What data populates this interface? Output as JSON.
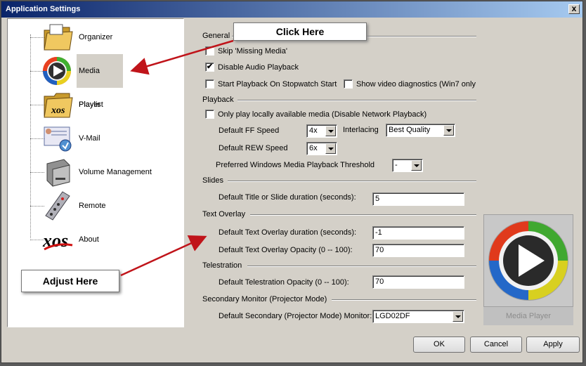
{
  "window": {
    "title": "Application Settings",
    "close_label": "x"
  },
  "sidebar": {
    "items": [
      {
        "label": "Organizer",
        "icon": "folder-icon"
      },
      {
        "label": "Media Player",
        "icon": "media-player-icon"
      },
      {
        "label": "Playlist",
        "icon": "playlist-folder-icon"
      },
      {
        "label": "V-Mail",
        "icon": "vmail-icon"
      },
      {
        "label": "Volume Management",
        "icon": "hard-drive-icon"
      },
      {
        "label": "Remote",
        "icon": "remote-control-icon"
      },
      {
        "label": "About",
        "icon": "xos-logo-icon"
      }
    ],
    "selected": "Media Player"
  },
  "general": {
    "title": "General",
    "skip_missing": {
      "label": "Skip 'Missing Media'",
      "checked": false
    },
    "disable_audio": {
      "label": "Disable Audio Playback",
      "checked": true
    },
    "start_playback": {
      "label": "Start Playback On Stopwatch Start",
      "checked": false
    },
    "show_diagnostics": {
      "label": "Show video diagnostics (Win7 only",
      "checked": false
    }
  },
  "playback": {
    "title": "Playback",
    "local_only": {
      "label": "Only play locally available media (Disable Network Playback)",
      "checked": false
    },
    "ff_label": "Default FF Speed",
    "ff_value": "4x",
    "interlacing_label": "Interlacing",
    "interlacing_value": "Best Quality",
    "rew_label": "Default REW Speed",
    "rew_value": "6x",
    "threshold_label": "Preferred Windows Media Playback Threshold",
    "threshold_value": "-"
  },
  "slides": {
    "title": "Slides",
    "duration_label": "Default Title or Slide duration (seconds):",
    "duration_value": "5"
  },
  "text_overlay": {
    "title": "Text Overlay",
    "duration_label": "Default Text Overlay duration (seconds):",
    "duration_value": "-1",
    "opacity_label": "Default Text Overlay Opacity (0 -- 100):",
    "opacity_value": "70"
  },
  "telestration": {
    "title": "Telestration",
    "opacity_label": "Default Telestration Opacity (0 -- 100):",
    "opacity_value": "70"
  },
  "secondary_monitor": {
    "title": "Secondary Monitor (Projector Mode)",
    "monitor_label": "Default Secondary (Projector Mode) Monitor:",
    "monitor_value": "LGD02DF"
  },
  "preview": {
    "caption": "Media Player",
    "icon": "media-player-icon"
  },
  "buttons": {
    "ok": "OK",
    "cancel": "Cancel",
    "apply": "Apply"
  },
  "annotations": {
    "click_here": "Click Here",
    "adjust_here": "Adjust Here",
    "arrow_color": "#c0141a"
  },
  "colors": {
    "titlebar": "#0a246a",
    "dialog": "#d4d0c8"
  }
}
